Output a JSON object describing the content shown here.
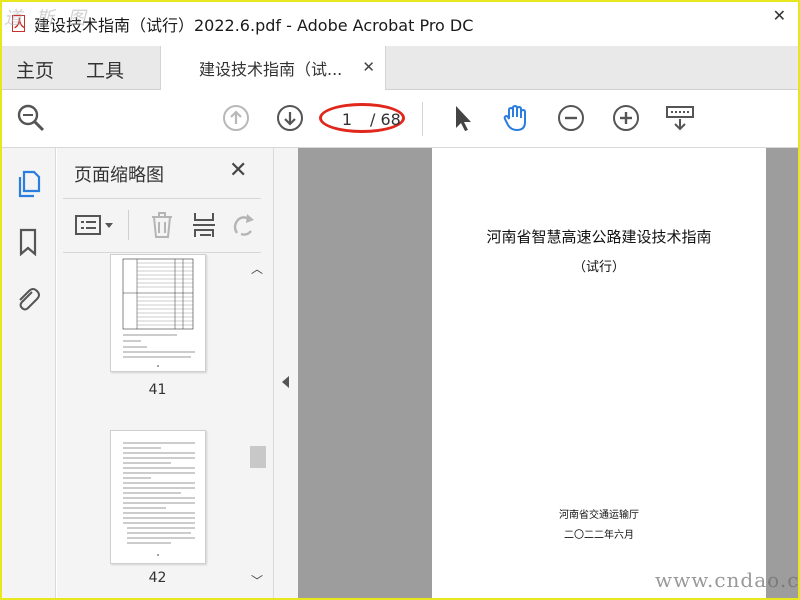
{
  "window": {
    "title": "建设技术指南（试行）2022.6.pdf - Adobe Acrobat Pro DC",
    "close_glyph": "✕"
  },
  "watermarks": {
    "top_left": "道 斯 图",
    "bottom_right": "www.cndao.c"
  },
  "tabs": {
    "home": "主页",
    "tools": "工具",
    "document": "建设技术指南（试...",
    "document_close": "✕"
  },
  "toolbar": {
    "current_page": "1",
    "total_pages": "/ 68",
    "icons": [
      "search-zoom-icon",
      "arrow-up-circle-icon",
      "arrow-down-circle-icon",
      "select-arrow-icon",
      "hand-icon",
      "zoom-out-icon",
      "zoom-in-icon",
      "read-mode-icon"
    ]
  },
  "rail": {
    "icons": [
      "pages-icon",
      "bookmark-icon",
      "attachment-icon"
    ]
  },
  "panel": {
    "title": "页面缩略图",
    "close_glyph": "✕",
    "thumbnails": [
      {
        "label": "41"
      },
      {
        "label": "42"
      }
    ]
  },
  "document": {
    "title": "河南省智慧高速公路建设技术指南",
    "subtitle": "（试行）",
    "issuer": "河南省交通运输厅",
    "date": "二〇二二年六月"
  },
  "colors": {
    "accent_blue": "#2b7de0",
    "highlight_red": "#e0271c",
    "frame_yellow": "#e8e61c"
  }
}
